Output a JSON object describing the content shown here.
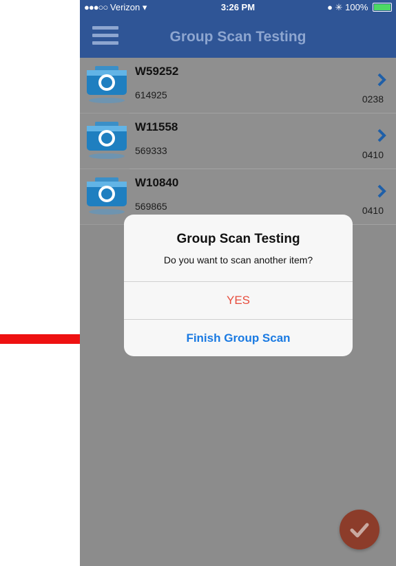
{
  "status_bar": {
    "carrier": "Verizon",
    "time": "3:26 PM",
    "battery": "100%"
  },
  "nav": {
    "title": "Group Scan Testing",
    "menu_icon": "hamburger-menu-icon"
  },
  "list": {
    "items": [
      {
        "title": "W59252",
        "subtitle": "614925",
        "code": "0238"
      },
      {
        "title": "W11558",
        "subtitle": "569333",
        "code": "0410"
      },
      {
        "title": "W10840",
        "subtitle": "569865",
        "code": "0410"
      }
    ]
  },
  "alert": {
    "title": "Group Scan Testing",
    "message": "Do you want to scan another item?",
    "yes_label": "YES",
    "finish_label": "Finish Group Scan"
  },
  "fab": {
    "icon": "checkmark-icon"
  },
  "colors": {
    "nav_blue": "#2f5596",
    "nav_text": "#8ea6d0",
    "yes_red": "#e74c3c",
    "finish_blue": "#1a7ae2",
    "fab_red": "#8c3c2a",
    "arrow_red": "#ee1111"
  }
}
